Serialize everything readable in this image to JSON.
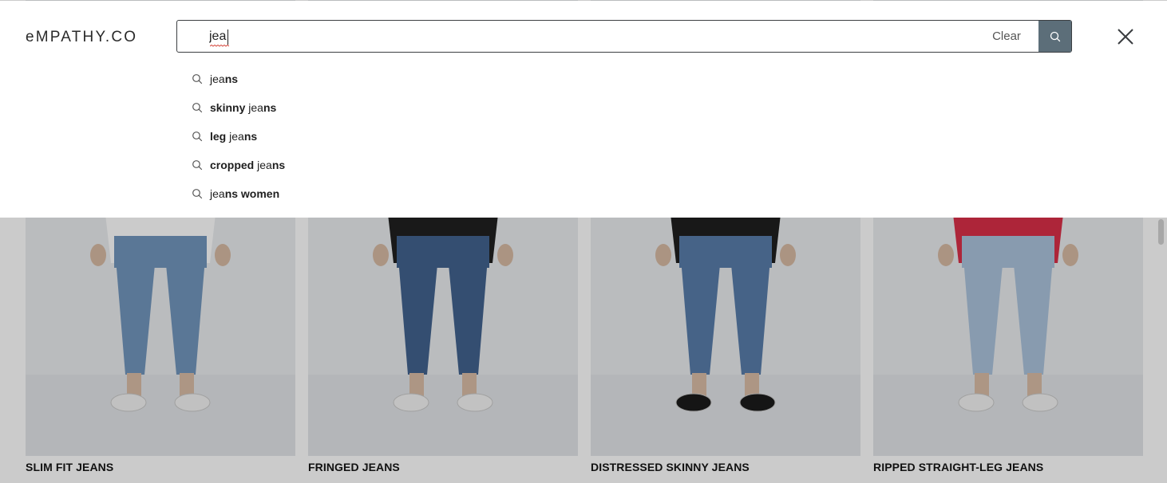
{
  "brand": {
    "logo_text": "eMPATHY.CO"
  },
  "search": {
    "value": "jea",
    "clear_label": "Clear",
    "accent_color": "#5c6e79"
  },
  "suggestions": [
    {
      "parts": [
        {
          "t": "jea",
          "bold": false
        },
        {
          "t": "ns",
          "bold": true
        }
      ]
    },
    {
      "parts": [
        {
          "t": "skinny ",
          "bold": true
        },
        {
          "t": "jea",
          "bold": false
        },
        {
          "t": "ns",
          "bold": true
        }
      ]
    },
    {
      "parts": [
        {
          "t": "leg ",
          "bold": true
        },
        {
          "t": "jea",
          "bold": false
        },
        {
          "t": "ns",
          "bold": true
        }
      ]
    },
    {
      "parts": [
        {
          "t": "cropped ",
          "bold": true
        },
        {
          "t": "jea",
          "bold": false
        },
        {
          "t": "ns",
          "bold": true
        }
      ]
    },
    {
      "parts": [
        {
          "t": "jea",
          "bold": false
        },
        {
          "t": "ns women",
          "bold": true
        }
      ]
    }
  ],
  "products": [
    {
      "title": "SLIM FIT JEANS",
      "denim": "#6f94bb",
      "top": "#ffffff",
      "shoe": "#f2f2f2"
    },
    {
      "title": "FRINGED JEANS",
      "denim": "#3e5f8c",
      "top": "#1c1c1c",
      "shoe": "#f4f4f4"
    },
    {
      "title": "DISTRESSED SKINNY JEANS",
      "denim": "#557aa8",
      "top": "#1a1a1a",
      "shoe": "#161616"
    },
    {
      "title": "RIPPED STRAIGHT-LEG JEANS",
      "denim": "#a9c2dc",
      "top": "#d92b45",
      "shoe": "#f2f2f2"
    }
  ]
}
